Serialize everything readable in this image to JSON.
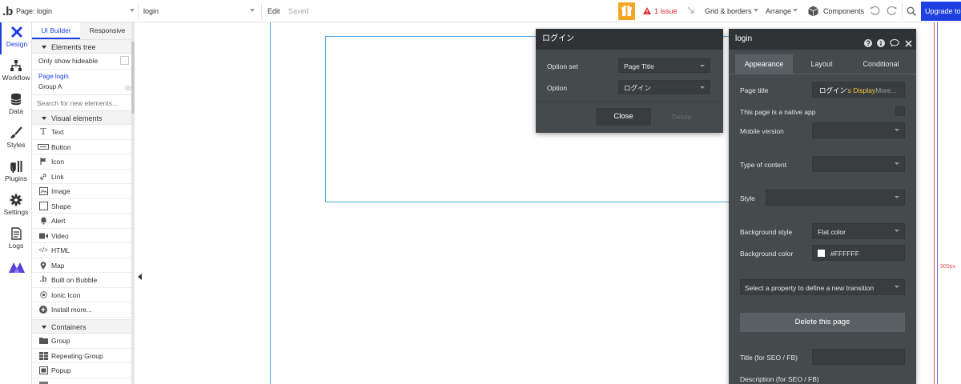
{
  "topbar": {
    "page_selector": "Page: login",
    "page_name": "login",
    "edit": "Edit",
    "status": "Saved",
    "issues": "1 issue",
    "grid_borders": "Grid & borders",
    "arrange": "Arrange",
    "components": "Components",
    "upgrade": "Upgrade to"
  },
  "iconbar": {
    "items": [
      {
        "label": "Design"
      },
      {
        "label": "Workflow"
      },
      {
        "label": "Data"
      },
      {
        "label": "Styles"
      },
      {
        "label": "Plugins"
      },
      {
        "label": "Settings"
      },
      {
        "label": "Logs"
      }
    ]
  },
  "panel": {
    "tab_ui_builder": "UI Builder",
    "tab_responsive": "Responsive",
    "elements_tree": "Elements tree",
    "only_hideable": "Only show hideable",
    "tree_page": "Page login",
    "tree_group": "Group A",
    "search_placeholder": "Search for new elements...",
    "visual_elements": "Visual elements",
    "visual": [
      "Text",
      "Button",
      "Icon",
      "Link",
      "Image",
      "Shape",
      "Alert",
      "Video",
      "HTML",
      "Map",
      "Built on Bubble",
      "Ionic Icon",
      "Install more..."
    ],
    "containers": "Containers",
    "container_items": [
      "Group",
      "Repeating Group",
      "Popup"
    ]
  },
  "canvas": {
    "width_marker": "900px"
  },
  "option_popup": {
    "title": "ログイン",
    "option_set_label": "Option set",
    "option_set_value": "Page Title",
    "option_label": "Option",
    "option_value": "ログイン",
    "close": "Close",
    "delete": "Delete"
  },
  "props": {
    "title": "login",
    "tabs": [
      "Appearance",
      "Layout",
      "Conditional"
    ],
    "page_title_label": "Page title",
    "page_title_value": "ログイン",
    "page_title_suffix": "'s Display",
    "page_title_more": "More...",
    "native_app": "This page is a native app",
    "mobile_version": "Mobile version",
    "type_of_content": "Type of content",
    "style": "Style",
    "bg_style_label": "Background style",
    "bg_style_value": "Flat color",
    "bg_color_label": "Background color",
    "bg_color_value": "#FFFFFF",
    "transition": "Select a property to define a new transition",
    "delete_page": "Delete this page",
    "seo_title": "Title (for SEO / FB)",
    "seo_desc": "Description (for SEO / FB)"
  },
  "colors": {
    "accent": "#1f40e0",
    "issue_red": "#e0262d",
    "panel_dark": "#454a4d",
    "orange": "#f5a623"
  }
}
